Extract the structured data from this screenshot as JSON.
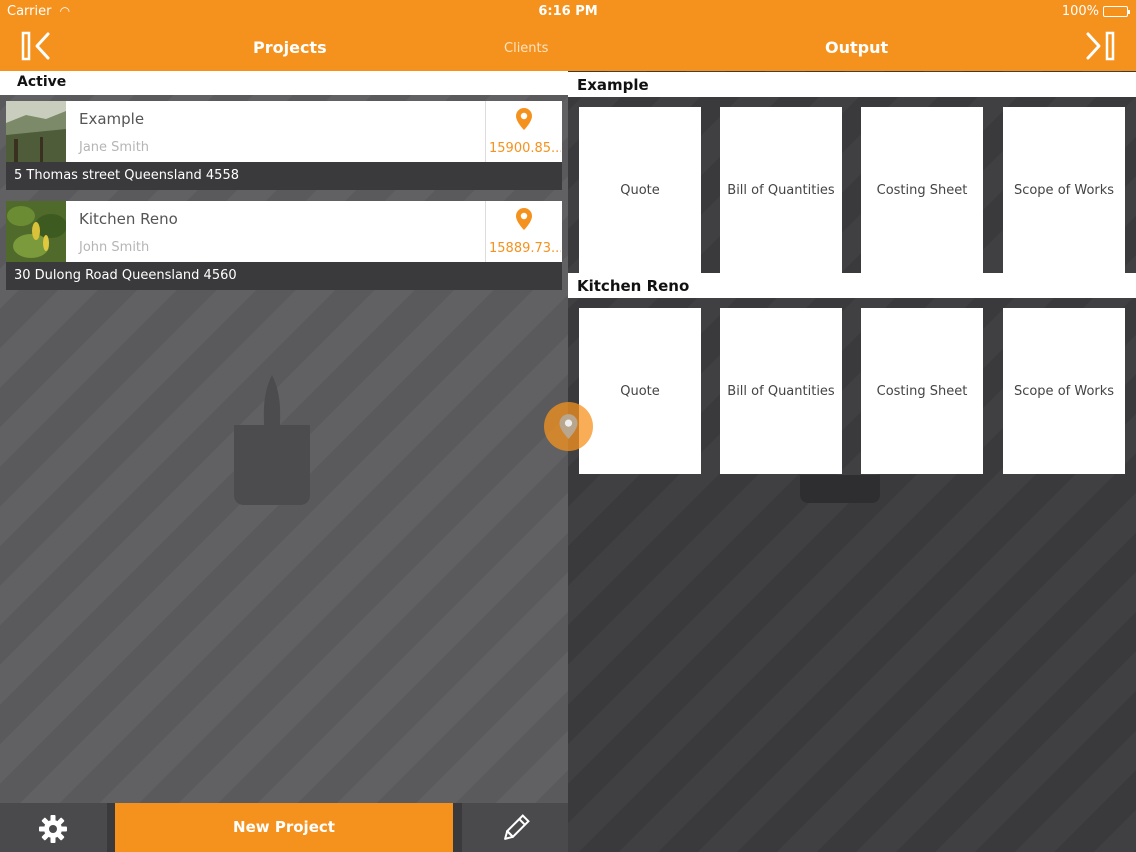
{
  "status_bar": {
    "carrier": "Carrier",
    "time": "6:16 PM",
    "battery": "100%"
  },
  "nav": {
    "projects": "Projects",
    "clients": "Clients",
    "output": "Output"
  },
  "left": {
    "section": "Active",
    "projects": [
      {
        "name": "Example",
        "client": "Jane Smith",
        "value": "15900.85...",
        "address": "5 Thomas street  Queensland 4558"
      },
      {
        "name": "Kitchen Reno",
        "client": "John Smith",
        "value": "15889.73...",
        "address": "30 Dulong Road  Queensland 4560"
      }
    ],
    "new_project": "New Project"
  },
  "right": {
    "groups": [
      {
        "title": "Example",
        "docs": [
          "Quote",
          "Bill of Quantities",
          "Costing Sheet",
          "Scope of Works"
        ]
      },
      {
        "title": "Kitchen Reno",
        "docs": [
          "Quote",
          "Bill of Quantities",
          "Costing Sheet",
          "Scope of Works"
        ]
      }
    ]
  },
  "colors": {
    "accent": "#f5921e",
    "dark": "#3a3a3c"
  }
}
